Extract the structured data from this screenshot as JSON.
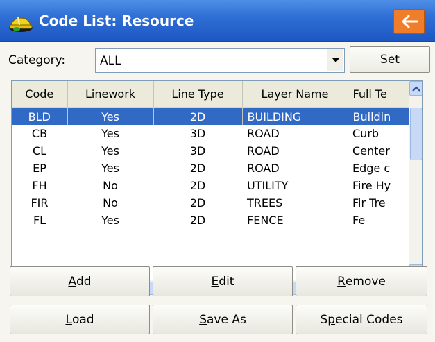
{
  "titlebar": {
    "title": "Code List: Resource",
    "app_icon": "hard-hat-icon",
    "back_icon": "back-arrow-icon",
    "back_color": "#ef7d2a"
  },
  "category": {
    "label": "Category:",
    "value": "ALL",
    "set_label": "Set"
  },
  "table": {
    "columns": [
      "Code",
      "Linework",
      "Line Type",
      "Layer Name",
      "Full Te"
    ],
    "rows": [
      {
        "code": "BLD",
        "linework": "Yes",
        "line_type": "2D",
        "layer": "BUILDING",
        "full": "Buildin"
      },
      {
        "code": "CB",
        "linework": "Yes",
        "line_type": "3D",
        "layer": "ROAD",
        "full": "Curb"
      },
      {
        "code": "CL",
        "linework": "Yes",
        "line_type": "3D",
        "layer": "ROAD",
        "full": "Center"
      },
      {
        "code": "EP",
        "linework": "Yes",
        "line_type": "2D",
        "layer": "ROAD",
        "full": "Edge c"
      },
      {
        "code": "FH",
        "linework": "No",
        "line_type": "2D",
        "layer": "UTILITY",
        "full": "Fire Hy"
      },
      {
        "code": "FIR",
        "linework": "No",
        "line_type": "2D",
        "layer": "TREES",
        "full": "Fir Tre"
      },
      {
        "code": "FL",
        "linework": "Yes",
        "line_type": "2D",
        "layer": "FENCE",
        "full": "Fe"
      }
    ],
    "selected_index": 0,
    "selection_color": "#316ac5"
  },
  "buttons": {
    "add": {
      "pre": "",
      "key": "A",
      "post": "dd"
    },
    "edit": {
      "pre": "",
      "key": "E",
      "post": "dit"
    },
    "remove": {
      "pre": "",
      "key": "R",
      "post": "emove"
    },
    "load": {
      "pre": "",
      "key": "L",
      "post": "oad"
    },
    "save_as": {
      "pre": "",
      "key": "S",
      "post": "ave As"
    },
    "special": {
      "pre": "S",
      "key": "p",
      "post": "ecial Codes"
    }
  }
}
